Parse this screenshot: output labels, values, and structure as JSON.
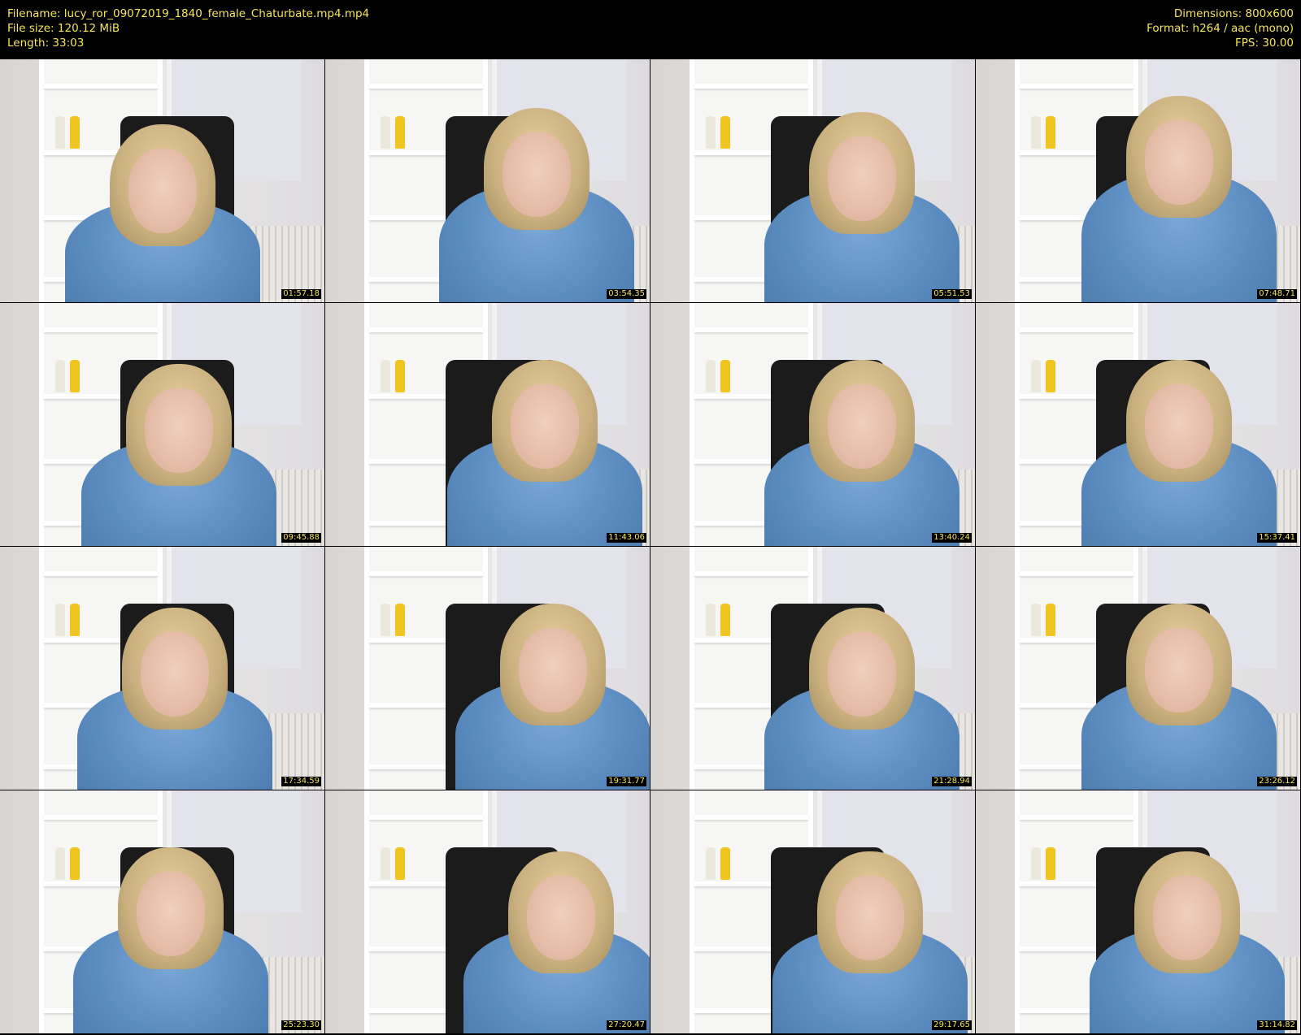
{
  "header": {
    "left": [
      "Filename: lucy_ror_09072019_1840_female_Chaturbate.mp4.mp4",
      "File size: 120.12 MiB",
      "Length: 33:03"
    ],
    "right": [
      "Dimensions: 800x600",
      "Format: h264 / aac (mono)",
      "FPS: 30.00"
    ]
  },
  "colors": {
    "header_text": "#f5e65a",
    "background": "#000000"
  },
  "thumbnails": [
    {
      "timestamp": "01:57.18"
    },
    {
      "timestamp": "03:54.35"
    },
    {
      "timestamp": "05:51.53"
    },
    {
      "timestamp": "07:48.71"
    },
    {
      "timestamp": "09:45.88"
    },
    {
      "timestamp": "11:43.06"
    },
    {
      "timestamp": "13:40.24"
    },
    {
      "timestamp": "15:37.41"
    },
    {
      "timestamp": "17:34.59"
    },
    {
      "timestamp": "19:31.77"
    },
    {
      "timestamp": "21:28.94"
    },
    {
      "timestamp": "23:26.12"
    },
    {
      "timestamp": "25:23.30"
    },
    {
      "timestamp": "27:20.47"
    },
    {
      "timestamp": "29:17.65"
    },
    {
      "timestamp": "31:14.82"
    }
  ]
}
